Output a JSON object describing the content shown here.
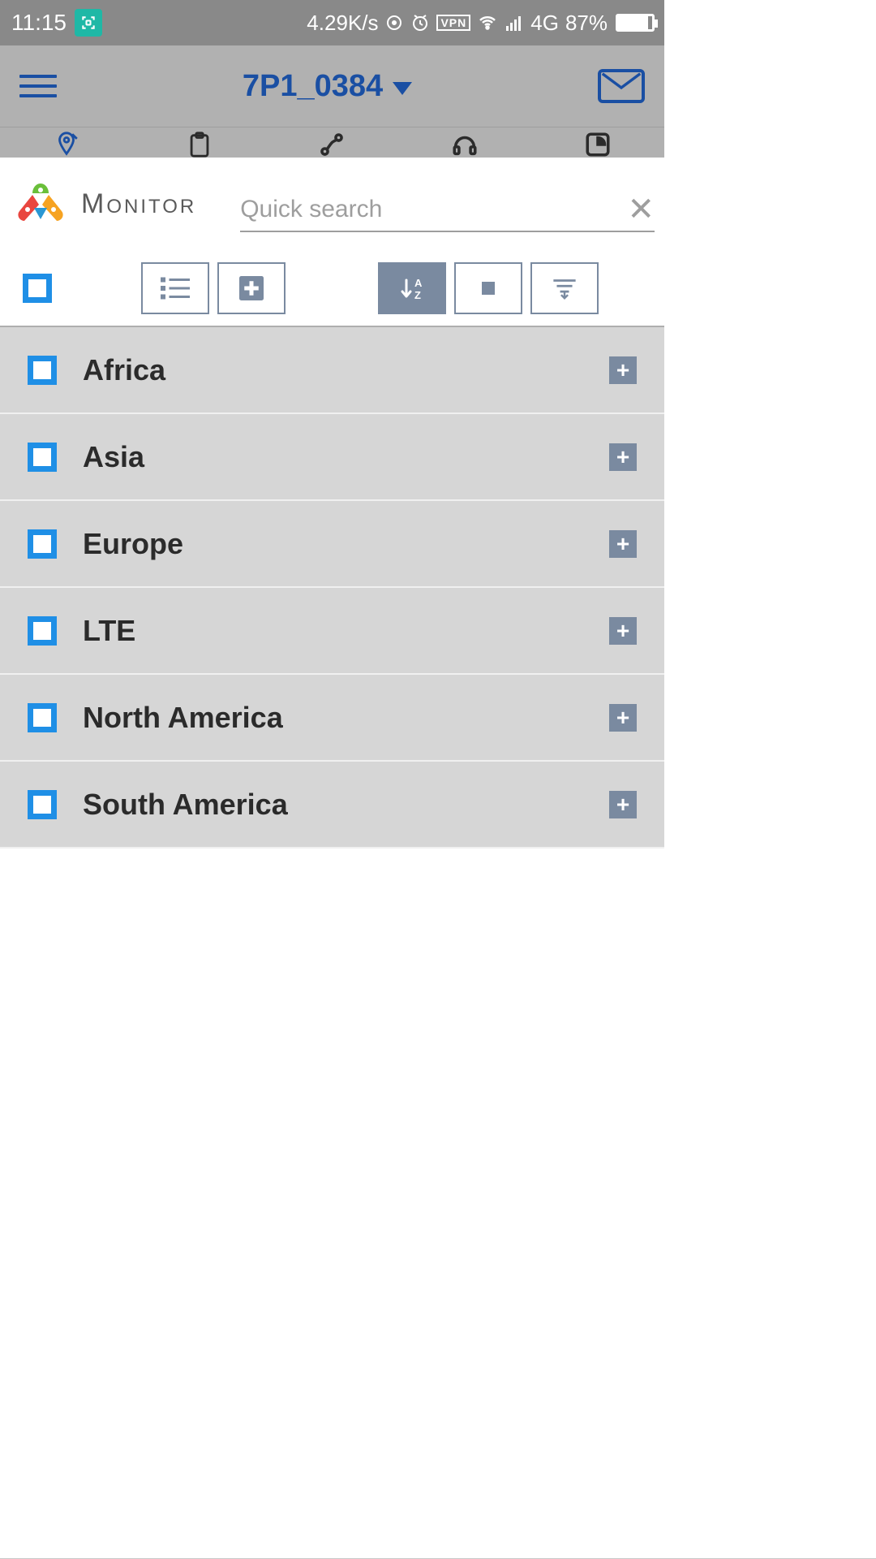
{
  "status": {
    "time": "11:15",
    "speed": "4.29K/s",
    "network": "4G",
    "battery": "87%"
  },
  "header": {
    "title": "7P1_0384"
  },
  "panel": {
    "brand": "Monitor",
    "search_placeholder": "Quick search"
  },
  "toolbar": {
    "sort_label": "A\nZ"
  },
  "regions": [
    {
      "label": "Africa"
    },
    {
      "label": "Asia"
    },
    {
      "label": "Europe"
    },
    {
      "label": "LTE"
    },
    {
      "label": "North America"
    },
    {
      "label": "South America"
    }
  ]
}
